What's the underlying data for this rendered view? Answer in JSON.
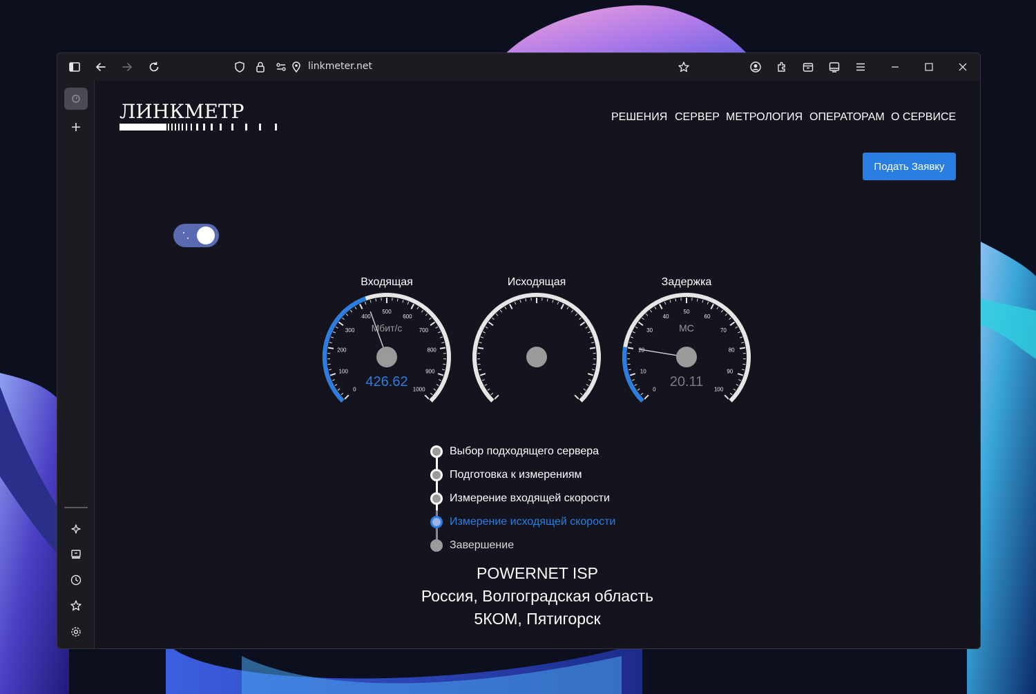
{
  "browser": {
    "url": "linkmeter.net"
  },
  "site": {
    "logo": "ЛИНКМЕТР",
    "nav": [
      "РЕШЕНИЯ",
      "СЕРВЕР",
      "МЕТРОЛОГИЯ",
      "ОПЕРАТОРАМ",
      "О СЕРВИСЕ"
    ],
    "apply_button": "Подать Заявку",
    "theme_toggle_on": true
  },
  "gauges": {
    "download": {
      "title": "Входящая",
      "unit": "Мбит/с",
      "value": 426.62,
      "value_text": "426.62",
      "max": 1000,
      "ticks": [
        "0",
        "100",
        "200",
        "300",
        "400",
        "500",
        "600",
        "700",
        "800",
        "900",
        "1000"
      ]
    },
    "upload": {
      "title": "Исходящая"
    },
    "latency": {
      "title": "Задержка",
      "unit": "МС",
      "value": 20.11,
      "value_text": "20.11",
      "max": 100,
      "ticks": [
        "0",
        "10",
        "20",
        "30",
        "40",
        "50",
        "60",
        "70",
        "80",
        "90",
        "100"
      ]
    }
  },
  "steps": [
    {
      "label": "Выбор подходящего сервера",
      "state": "done"
    },
    {
      "label": "Подготовка к измерениям",
      "state": "done"
    },
    {
      "label": "Измерение входящей скорости",
      "state": "done"
    },
    {
      "label": "Измерение исходящей скорости",
      "state": "active"
    },
    {
      "label": "Завершение",
      "state": "pending"
    }
  ],
  "isp": {
    "name": "POWERNET ISP",
    "region": "Россия, Волгоградская область",
    "server": "5КОМ, Пятигорск"
  },
  "colors": {
    "accent": "#2a7de1",
    "gauge_arc": "#e6e6e6",
    "gauge_active": "#2a7de1",
    "page_bg": "#13141d"
  }
}
